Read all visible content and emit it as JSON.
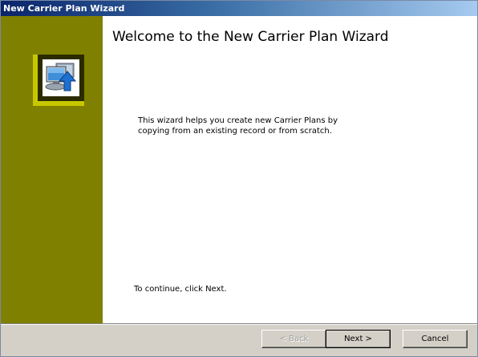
{
  "window": {
    "title": "New Carrier Plan Wizard"
  },
  "sidebar": {
    "icon": "computer-upload-icon",
    "background_color": "#808000",
    "accent_color": "#c8c800"
  },
  "main": {
    "heading": "Welcome to the New Carrier Plan Wizard",
    "intro_lines": [
      "This wizard helps you create new Carrier Plans by",
      "copying from an existing record or from scratch."
    ],
    "continue_text": "To continue, click Next."
  },
  "footer": {
    "back_label": "< Back",
    "back_enabled": false,
    "next_label": "Next >",
    "cancel_label": "Cancel"
  }
}
